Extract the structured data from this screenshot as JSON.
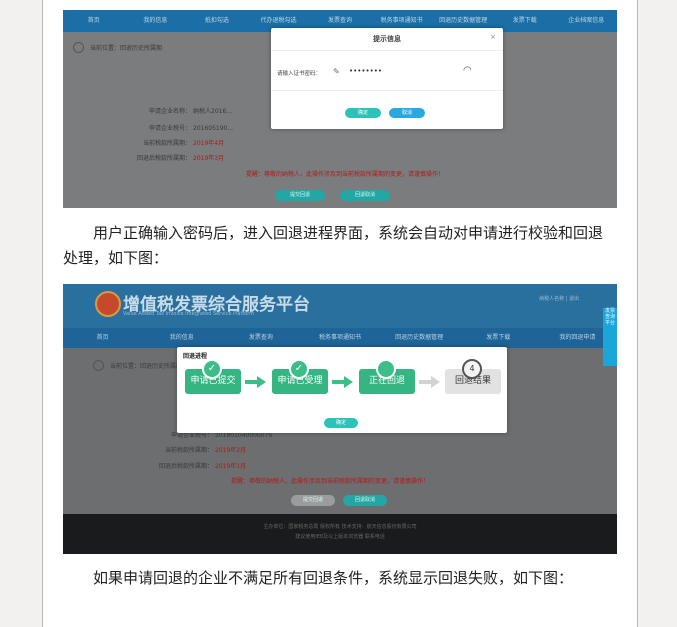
{
  "screenshot1": {
    "nav": [
      "首页",
      "我的信息",
      "抵扣勾选",
      "代办退税勾选",
      "发票查询",
      "税务事项通知书",
      "回退历史数据管理",
      "发票下载",
      "企业档案信息"
    ],
    "breadcrumb": "当前位置：回退历史所属期",
    "form": [
      {
        "label": "申请企业名称：",
        "value": "纳税人2016..."
      },
      {
        "label": "申请企业税号：",
        "value": "201605190..."
      },
      {
        "label": "当前税款所属期：",
        "value": "2019年4月"
      },
      {
        "label": "回退后税款所属期：",
        "value": "2019年3月"
      }
    ],
    "warning": "提醒：尊敬的纳税人，此操作涉及到当前税款所属期的变更，请谨慎操作！",
    "buttons": {
      "submit": "提交回退",
      "cancel": "回退取消"
    },
    "dialog": {
      "title": "提示信息",
      "close": "×",
      "label": "请输入证书密码：",
      "password": "••••••••",
      "ok": "确定",
      "cancel": "取消"
    }
  },
  "para1": "用户正确输入密码后，进入回退进程界面，系统会自动对申请进行校验和回退处理，如下图：",
  "screenshot2": {
    "title": "增值税发票综合服务平台",
    "subtitle": "Value Added Tax Invoice Integrated Service Platform",
    "user": "纳税人名称 | 退出",
    "nav": [
      "首页",
      "我的信息",
      "发票查询",
      "税务事项通知书",
      "回退历史数据管理",
      "发票下载",
      "我的回退申请"
    ],
    "side_tab": "发票查询平台",
    "breadcrumb": "当前位置：回退历史所属期",
    "dialog_title": "回退进程",
    "steps": [
      {
        "label": "申请已提交",
        "icon": "check-icon"
      },
      {
        "label": "申请已受理",
        "icon": "check-icon"
      },
      {
        "label": "正在回退",
        "icon": "circle-icon"
      },
      {
        "label": "回退结果",
        "num": "4"
      }
    ],
    "ok": "确定",
    "form": [
      {
        "label": "申请企业税号：",
        "value": "201801040000075"
      },
      {
        "label": "当前税款所属期：",
        "value": "2019年2月"
      },
      {
        "label": "回退后税款所属期：",
        "value": "2019年1月"
      }
    ],
    "warning": "提醒：尊敬的纳税人，此操作涉及到当前税款所属期的变更，请谨慎操作！",
    "buttons": {
      "submit": "提交回退",
      "cancel": "回退取消"
    },
    "footer": [
      "主办单位：国家税务总局 版权所有 技术支持：航天信息股份有限公司",
      "建议使用IE8及以上版本浏览器 联系电话"
    ]
  },
  "para2": "如果申请回退的企业不满足所有回退条件，系统显示回退失败，如下图："
}
